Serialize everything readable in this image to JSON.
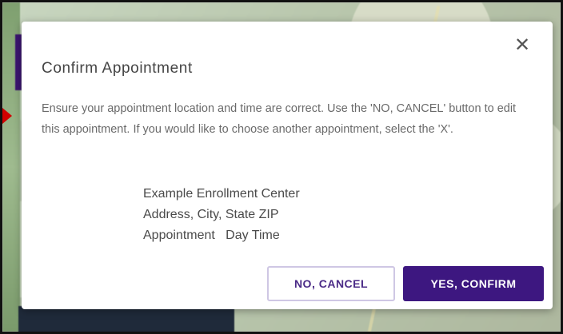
{
  "dialog": {
    "title": "Confirm Appointment",
    "close_icon": "close-icon",
    "message": "Ensure your appointment location and time are correct. Use the 'NO, CANCEL' button to edit this appointment. If you would like to choose another appointment, select the 'X'.",
    "details": {
      "location": "Example Enrollment Center",
      "address": "Address, City, State ZIP",
      "datetime": "Appointment   Day Time"
    },
    "buttons": {
      "cancel": "NO, CANCEL",
      "confirm": "YES, CONFIRM"
    }
  },
  "colors": {
    "primary": "#3d1780",
    "marker": "#d10000"
  }
}
